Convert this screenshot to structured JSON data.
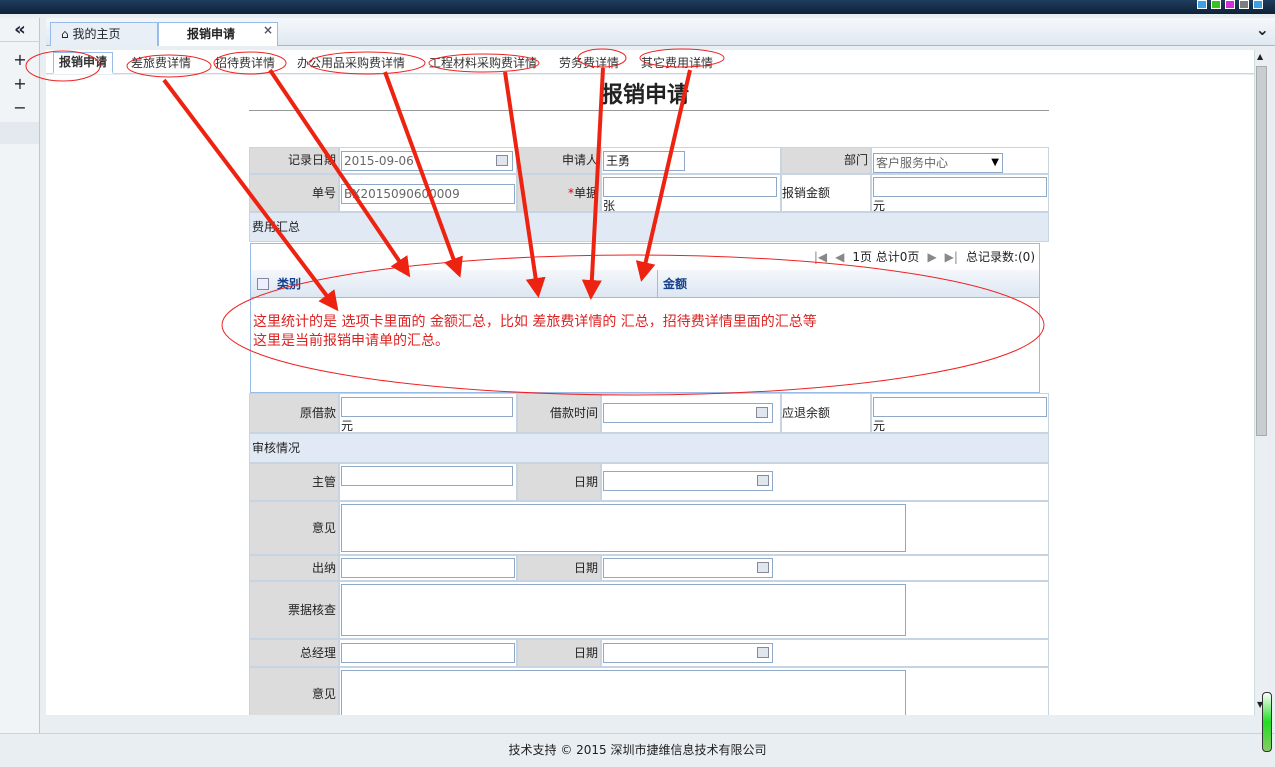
{
  "window": {
    "icon_colors": [
      "#3aa3e8",
      "#35c61b",
      "#d32ddc",
      "#7d7d7d",
      "#3aa3e8"
    ]
  },
  "left_nav": {
    "collapse": "«",
    "items": [
      "+",
      "+",
      "−"
    ]
  },
  "tabs": [
    {
      "label": "我的主页"
    },
    {
      "label": "报销申请",
      "close": "×"
    }
  ],
  "tab_menu": "⌄",
  "subtabs": [
    "报销申请",
    "差旅费详情",
    "招待费详情",
    "办公用品采购费详情",
    "工程材料采购费详情",
    "劳务费详情",
    "其它费用详情"
  ],
  "form": {
    "title": "报销申请",
    "record_date": {
      "label": "记录日期",
      "value": "2015-09-06"
    },
    "applicant": {
      "label": "申请人",
      "value": "王勇"
    },
    "department": {
      "label": "部门",
      "value": "客户服务中心"
    },
    "doc_no": {
      "label": "单号",
      "value": "BX2015090600009"
    },
    "doc_count": {
      "label": "单据",
      "unit": "张",
      "required": "*"
    },
    "amount": {
      "label": "报销金额",
      "unit": "元"
    },
    "summary_title": "费用汇总",
    "pager": {
      "page": "1页 总计0页",
      "total": "总记录数:(0)"
    },
    "grid_cols": [
      "类别",
      "金额"
    ],
    "annotation": [
      "这里统计的是 选项卡里面的 金额汇总，比如 差旅费详情的 汇总，招待费详情里面的汇总等",
      "这里是当前报销申请单的汇总。"
    ],
    "original_loan": {
      "label": "原借款",
      "unit": "元"
    },
    "loan_time": {
      "label": "借款时间"
    },
    "refund": {
      "label": "应退余额",
      "unit": "元"
    },
    "review_title": "审核情况",
    "supervisor": {
      "label": "主管"
    },
    "date_label": "日期",
    "opinion": "意见",
    "cashier": {
      "label": "出纳"
    },
    "receipt_check": {
      "label": "票据核查"
    },
    "gm": {
      "label": "总经理"
    }
  },
  "footer": "技术支持 © 2015 深圳市捷维信息技术有限公司",
  "colors": {
    "annotation": "#dd2222",
    "tab_border": "#99bbe8"
  }
}
